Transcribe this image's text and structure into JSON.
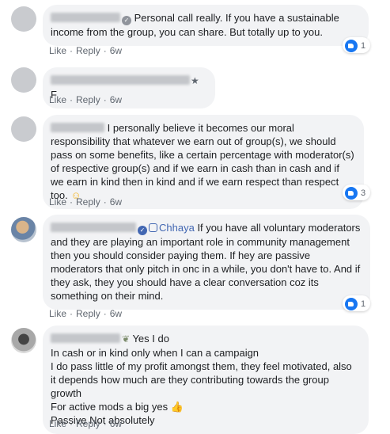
{
  "comments": [
    {
      "text": "Personal call really. If you have a sustainable income from the group, you can share. But totally up to you.",
      "actions": {
        "like": "Like",
        "reply": "Reply",
        "time": "6w"
      },
      "reactions": "1"
    },
    {
      "text": "F",
      "actions": {
        "like": "Like",
        "reply": "Reply",
        "time": "6w"
      }
    },
    {
      "text": "I personally believe it becomes our moral responsibility that whatever we earn out of group(s), we should pass on some benefits, like a certain percentage with moderator(s) of respective group(s) and if we earn in cash than in cash and if we earn in kind then in kind and if we earn respect than respect too.",
      "emoji": "☺",
      "actions": {
        "like": "Like",
        "reply": "Reply",
        "time": "6w"
      },
      "reactions": "3"
    },
    {
      "role": "Chhaya",
      "text": "If you have all voluntary moderators and they are playing an important role in community management then you should consider paying them. If hey are passive moderators that only pitch in onc in a while, you don't have to. And if they ask, they you should have a clear conversation coz its something on their mind.",
      "actions": {
        "like": "Like",
        "reply": "Reply",
        "time": "6w"
      },
      "reactions": "1"
    },
    {
      "first_line": "Yes I do",
      "lines": [
        "In cash or in kind only when I can a campaign",
        "I do pass little of my profit amongst them, they feel motivated, also it depends how much are they contributing towards the group growth",
        "For active mods a big yes",
        "Passive Not absolutely"
      ],
      "emoji": "👍",
      "actions": {
        "like": "Like",
        "reply": "Reply",
        "time": "6w"
      }
    }
  ]
}
